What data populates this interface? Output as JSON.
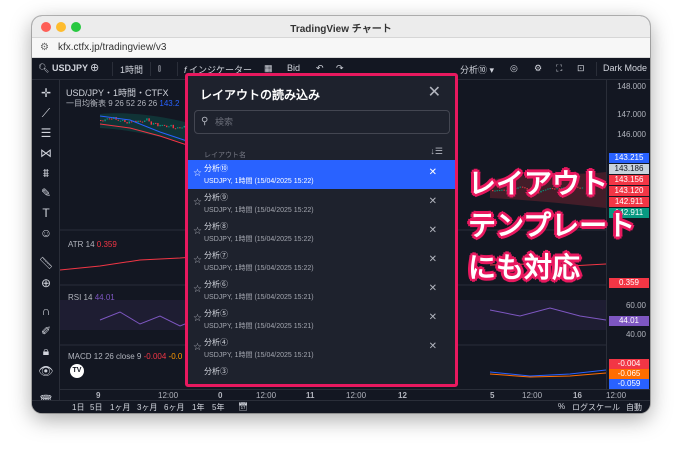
{
  "window": {
    "title": "TradingView チャート",
    "url": "kfx.ctfx.jp/tradingview/v3"
  },
  "toolbar": {
    "symbol": "USDJPY",
    "interval": "1時間",
    "indicators": "インジケーター",
    "bid": "Bid",
    "layout_name": "分析⑩",
    "theme": "Dark Mode"
  },
  "chart": {
    "legend_main": "USD/JPY・1時間・CTFX",
    "legend_ichimoku": "一目均衡表 9 26 52 26 26",
    "legend_ichimoku_value": "143.2",
    "atr_label": "ATR 14",
    "atr_value": "0.359",
    "rsi_label": "RSI 14",
    "rsi_value": "44.01",
    "macd_label": "MACD 12 26 close 9",
    "macd_values": [
      "-0.004",
      "-0.0"
    ],
    "prices": [
      "148.000",
      "147.000",
      "146.000",
      "60.00",
      "40.00",
      "0.000"
    ],
    "price_tags": [
      {
        "text": "143.215",
        "color": "#2962ff"
      },
      {
        "text": "143.186",
        "color": "#c9d3dc"
      },
      {
        "text": "143.156",
        "color": "#f23645"
      },
      {
        "text": "143.120",
        "color": "#f23645"
      },
      {
        "text": "142.911",
        "color": "#f23645"
      },
      {
        "text": "142.911",
        "color": "#089981"
      }
    ],
    "atr_tag": "0.359",
    "rsi_tag": "44.01",
    "macd_tags": [
      "-0.004",
      "-0.065",
      "-0.059"
    ],
    "time_labels": [
      "9",
      "12:00",
      "0",
      "12:00",
      "11",
      "12:00",
      "12",
      "5",
      "12:00",
      "16",
      "12:00"
    ]
  },
  "bottom": {
    "ranges": [
      "1日",
      "5日",
      "1ヶ月",
      "3ヶ月",
      "6ヶ月",
      "1年",
      "5年"
    ],
    "percent": "%",
    "log": "ログスケール",
    "auto": "自動"
  },
  "dialog": {
    "title": "レイアウトの読み込み",
    "search_placeholder": "検索",
    "column_header": "レイアウト名",
    "items": [
      {
        "name": "分析⑩",
        "sub": "USDJPY, 1時間 (15/04/2025 15:22)",
        "selected": true
      },
      {
        "name": "分析⑨",
        "sub": "USDJPY, 1時間 (15/04/2025 15:22)"
      },
      {
        "name": "分析⑧",
        "sub": "USDJPY, 1時間 (15/04/2025 15:22)"
      },
      {
        "name": "分析⑦",
        "sub": "USDJPY, 1時間 (15/04/2025 15:22)"
      },
      {
        "name": "分析⑥",
        "sub": "USDJPY, 1時間 (15/04/2025 15:21)"
      },
      {
        "name": "分析⑤",
        "sub": "USDJPY, 1時間 (15/04/2025 15:21)"
      },
      {
        "name": "分析④",
        "sub": "USDJPY, 1時間 (15/04/2025 15:21)"
      },
      {
        "name": "分析③",
        "sub": ""
      }
    ]
  },
  "callout": [
    "レイアウト",
    "テンプレート",
    "にも対応"
  ],
  "colors": {
    "accent": "#e8195f",
    "selection": "#2962ff",
    "background": "#131722"
  }
}
